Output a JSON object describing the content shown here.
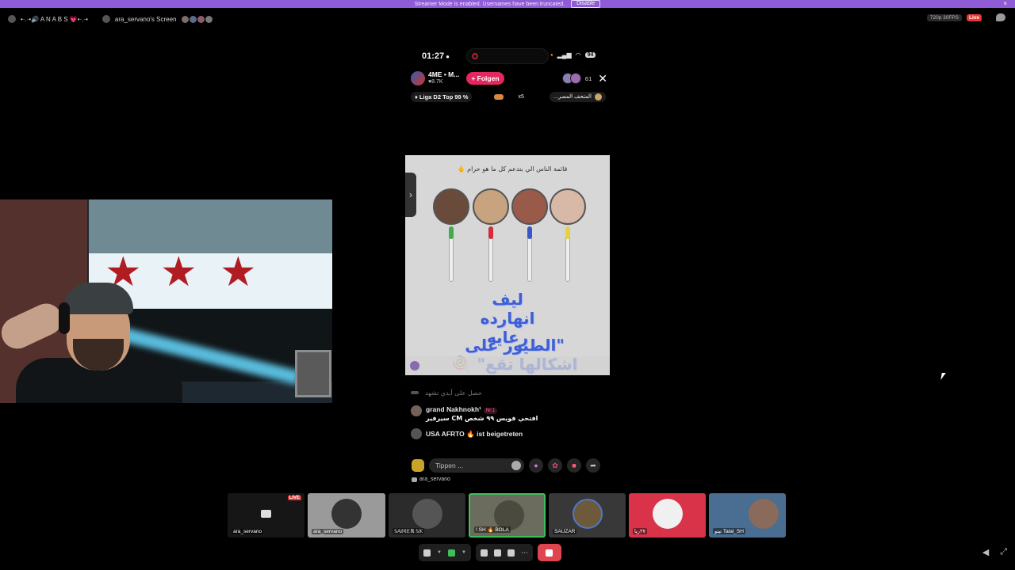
{
  "banner": {
    "text": "Streamer Mode is enabled. Usernames have been truncated.",
    "disable_label": "Disable",
    "close_glyph": "×"
  },
  "topbar": {
    "channel_name": "•·.·•🔊 A N A B S 💗•·.·•",
    "screen_title": "ara_servano's Screen",
    "quality": "720p 30FPS",
    "live_label": "Live"
  },
  "phone": {
    "time": "01:27",
    "battery": "94",
    "host_name": "4ME • M...",
    "host_likes": "8.7K",
    "follow_label": "+ Folgen",
    "viewer_count": "61",
    "close_glyph": "✕",
    "league": "Liga D2 Top 99 %",
    "gift_count": "x5",
    "rank_label": "...المتحف المصر",
    "card_title": "قائمة الناس الي بتدعم كل ما هو حرام 🖕",
    "card_line1": "ليف انهارده رعايه",
    "card_line2": "\"الطيور على اشكالها تقع\" 🍭",
    "side_arrow": "›"
  },
  "chat": {
    "faded_line": "حصل على أيدي تشهد",
    "msg_name": "grand Nakhnokh¹",
    "msg_badge": "Nr.1",
    "msg_text": "افتحي فويس ٩٩ شخص CM سيرفير",
    "join_text": "USA AFRTO 🔥 ist beigetreten",
    "input_placeholder": "Tippen ...",
    "below_name": "ara_servano"
  },
  "tiles": [
    {
      "label": "ara_servano",
      "live": "LIVE"
    },
    {
      "label": "ara_servano"
    },
    {
      "label": "𝕊𝔸𝕄𝔼ℝ 𝕊𝕂"
    },
    {
      "label": "! SH 🔥 BOLA"
    },
    {
      "label": "SAUZAR"
    },
    {
      "label": "٢٧ريا"
    },
    {
      "label": "تيتو Talal_SH"
    }
  ],
  "colors": {
    "banner": "#8f5bd6",
    "follow": "#e5275f",
    "live": "#e53935",
    "camera_on": "#3fbf5a",
    "end_call": "#e0454f"
  },
  "icons": [
    "microphone-icon",
    "camera-icon",
    "screen-share-icon",
    "activities-icon",
    "soundboard-icon",
    "more-icon",
    "end-stream-icon",
    "volume-icon",
    "fullscreen-icon"
  ]
}
